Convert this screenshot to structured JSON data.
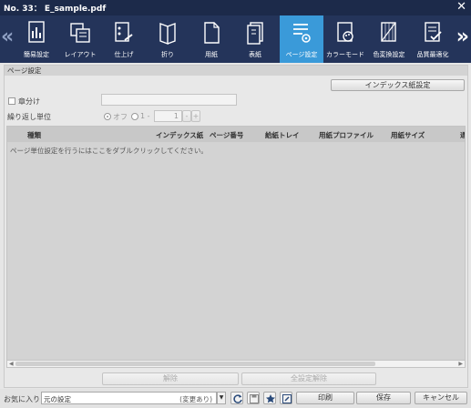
{
  "window": {
    "title": "No. 33： E_sample.pdf"
  },
  "toolbar": {
    "items": [
      {
        "label": "簡易設定",
        "icon": "basic-settings-icon"
      },
      {
        "label": "レイアウト",
        "icon": "layout-icon"
      },
      {
        "label": "仕上げ",
        "icon": "finishing-icon"
      },
      {
        "label": "折り",
        "icon": "fold-icon"
      },
      {
        "label": "用紙",
        "icon": "paper-icon"
      },
      {
        "label": "表紙",
        "icon": "cover-icon"
      },
      {
        "label": "ページ設定",
        "icon": "page-settings-icon",
        "active": true
      },
      {
        "label": "カラーモード",
        "icon": "color-mode-icon"
      },
      {
        "label": "色変換設定",
        "icon": "color-conversion-icon"
      },
      {
        "label": "品質最適化",
        "icon": "quality-optimization-icon"
      }
    ]
  },
  "page_settings": {
    "section_title": "ページ設定",
    "index_paper_button": "インデックス紙設定",
    "chapter_label": "章分け",
    "repeat_label": "繰り返し単位",
    "radio_off": "オフ",
    "radio_1": "1 -",
    "stepper_value": "1",
    "stepper_minus": "-",
    "stepper_plus": "+",
    "table": {
      "columns": [
        "種類",
        "インデックス紙",
        "ページ番号",
        "給紙トレイ",
        "用紙プロファイル",
        "用紙サイズ",
        "通"
      ],
      "hint": "ページ単位設定を行うにはここをダブルクリックしてください。"
    },
    "delete_button": "解除",
    "clear_all_button": "全設定解除"
  },
  "bottom": {
    "favorites_label": "お気に入り",
    "favorites_value": "元の設定",
    "favorites_status": "(変更あり)",
    "print_button": "印刷",
    "save_button": "保存",
    "cancel_button": "キャンセル"
  },
  "colors": {
    "title_bg": "#1c2a4a",
    "toolbar_bg": "#24345a",
    "active_tab": "#3a9ad9"
  }
}
